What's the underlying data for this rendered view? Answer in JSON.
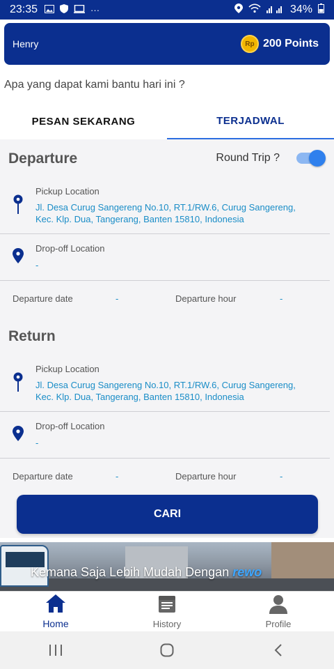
{
  "status_bar": {
    "time": "23:35",
    "more": "···",
    "battery": "34%"
  },
  "header": {
    "user_name": "Henry",
    "coin_symbol": "Rp",
    "points": "200 Points"
  },
  "greeting": "Apa yang dapat kami bantu hari ini ?",
  "tabs": [
    {
      "label": "PESAN SEKARANG",
      "active": false
    },
    {
      "label": "TERJADWAL",
      "active": true
    }
  ],
  "departure": {
    "title": "Departure",
    "round_trip_label": "Round Trip ?",
    "round_trip_enabled": true,
    "pickup_label": "Pickup Location",
    "pickup_value_line1": "Jl. Desa Curug Sangereng No.10, RT.1/RW.6, Curug Sangereng,",
    "pickup_value_line2": "Kec. Klp. Dua, Tangerang, Banten 15810, Indonesia",
    "dropoff_label": "Drop-off Location",
    "dropoff_value": "-",
    "date_label": "Departure date",
    "date_value": "-",
    "hour_label": "Departure hour",
    "hour_value": "-"
  },
  "return": {
    "title": "Return",
    "pickup_label": "Pickup Location",
    "pickup_value_line1": "Jl. Desa Curug Sangereng No.10, RT.1/RW.6, Curug Sangereng,",
    "pickup_value_line2": "Kec. Klp. Dua, Tangerang, Banten 15810, Indonesia",
    "dropoff_label": "Drop-off Location",
    "dropoff_value": "-",
    "date_label": "Departure date",
    "date_value": "-",
    "hour_label": "Departure hour",
    "hour_value": "-"
  },
  "search_button": "CARI",
  "banner": {
    "text": "Kemana Saja Lebih Mudah Dengan",
    "brand": "rewo"
  },
  "bottom_nav": [
    {
      "label": "Home",
      "icon": "home-icon",
      "active": true
    },
    {
      "label": "History",
      "icon": "history-icon",
      "active": false
    },
    {
      "label": "Profile",
      "icon": "profile-icon",
      "active": false
    }
  ],
  "colors": {
    "primary": "#0b2f8f",
    "link": "#1a8dc7",
    "accent": "#2f80ed"
  }
}
